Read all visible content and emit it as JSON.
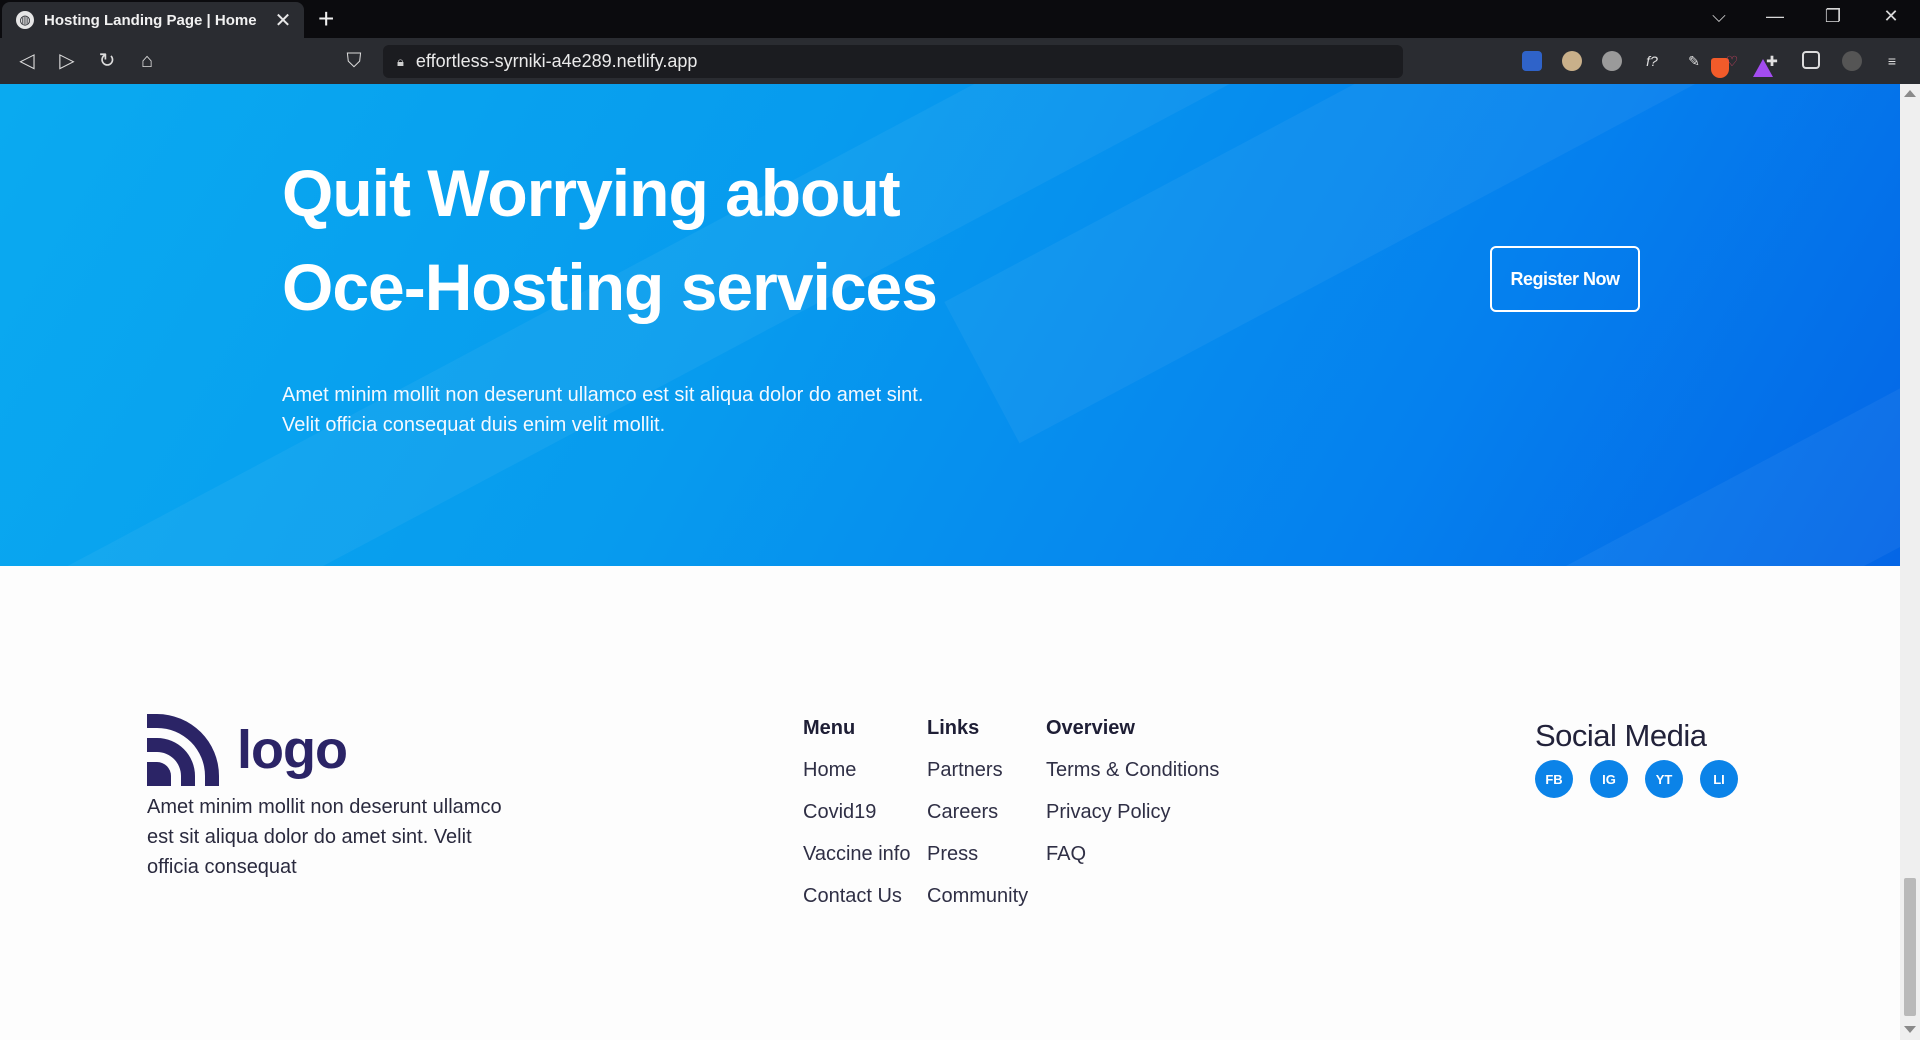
{
  "browser": {
    "tab_title": "Hosting Landing Page | Home",
    "tab_close": "✕",
    "new_tab": "+",
    "url": "effortless-syrniki-a4e289.netlify.app",
    "window_controls": {
      "dropdown": "⌵",
      "minimize": "—",
      "restore": "❐",
      "close": "✕"
    },
    "nav_icons": {
      "back": "◁",
      "forward": "▷",
      "reload": "↻",
      "home": "⌂",
      "bookmark": "⛉"
    },
    "extensions": [
      "shield-ext-icon",
      "eyes-ext-icon",
      "pacman-ext-icon",
      "font-ext-icon",
      "pen-ext-icon",
      "pocket-ext-icon",
      "puzzle-ext-icon",
      "sidebar-icon",
      "profile-icon",
      "menu-icon"
    ]
  },
  "hero": {
    "title_line1": "Quit Worrying about",
    "title_line2": "Oce-Hosting services",
    "description": "Amet minim mollit non deserunt ullamco est sit aliqua dolor do amet sint. Velit officia consequat duis enim velit mollit.",
    "register_label": "Register Now",
    "gradient": [
      "#0aaaf0",
      "#0466e6"
    ]
  },
  "footer": {
    "logo_text": "logo",
    "description": "Amet minim mollit non deserunt ullamco est sit aliqua dolor do amet sint. Velit officia consequat",
    "columns": [
      {
        "heading": "Menu",
        "links": [
          "Home",
          "Covid19",
          "Vaccine info",
          "Contact Us"
        ]
      },
      {
        "heading": "Links",
        "links": [
          "Partners",
          "Careers",
          "Press",
          "Community"
        ]
      },
      {
        "heading": "Overview",
        "links": [
          "Terms & Conditions",
          "Privacy Policy",
          "FAQ"
        ]
      }
    ],
    "social_title": "Social Media",
    "social": [
      "FB",
      "IG",
      "YT",
      "LI"
    ],
    "accent_color": "#0b83e8",
    "logo_color": "#2b2466"
  }
}
